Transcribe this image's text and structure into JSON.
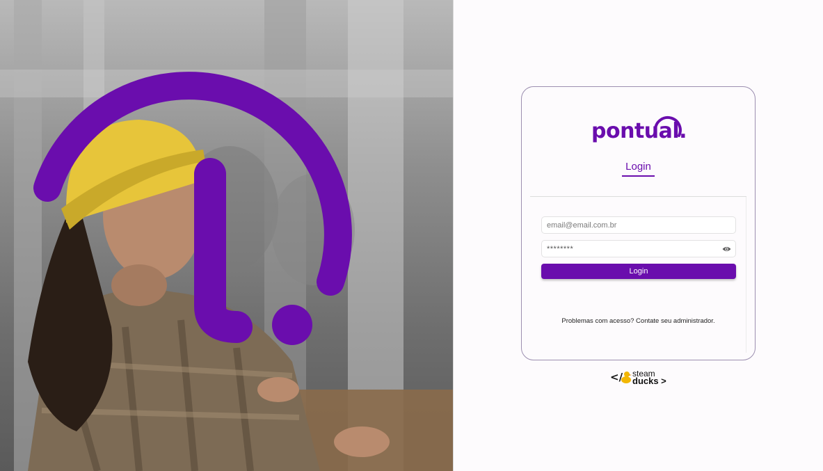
{
  "hero": {
    "description_icon": "pontual-logo-mark"
  },
  "brand": {
    "logo_text": "pontual."
  },
  "tabs": [
    {
      "label": "Login",
      "active": true
    }
  ],
  "form": {
    "email_placeholder": "email@email.com.br",
    "password_value": "********",
    "password_icon": "eye-icon",
    "submit_label": "Login"
  },
  "help_text": "Problemas com acesso? Contate seu administrador.",
  "footer_brand": {
    "left": "</",
    "line1": "steam",
    "line2": "ducks >"
  },
  "colors": {
    "accent": "#6a0dad",
    "background": "#fdfbfd",
    "card_border": "#9c8fb0"
  }
}
